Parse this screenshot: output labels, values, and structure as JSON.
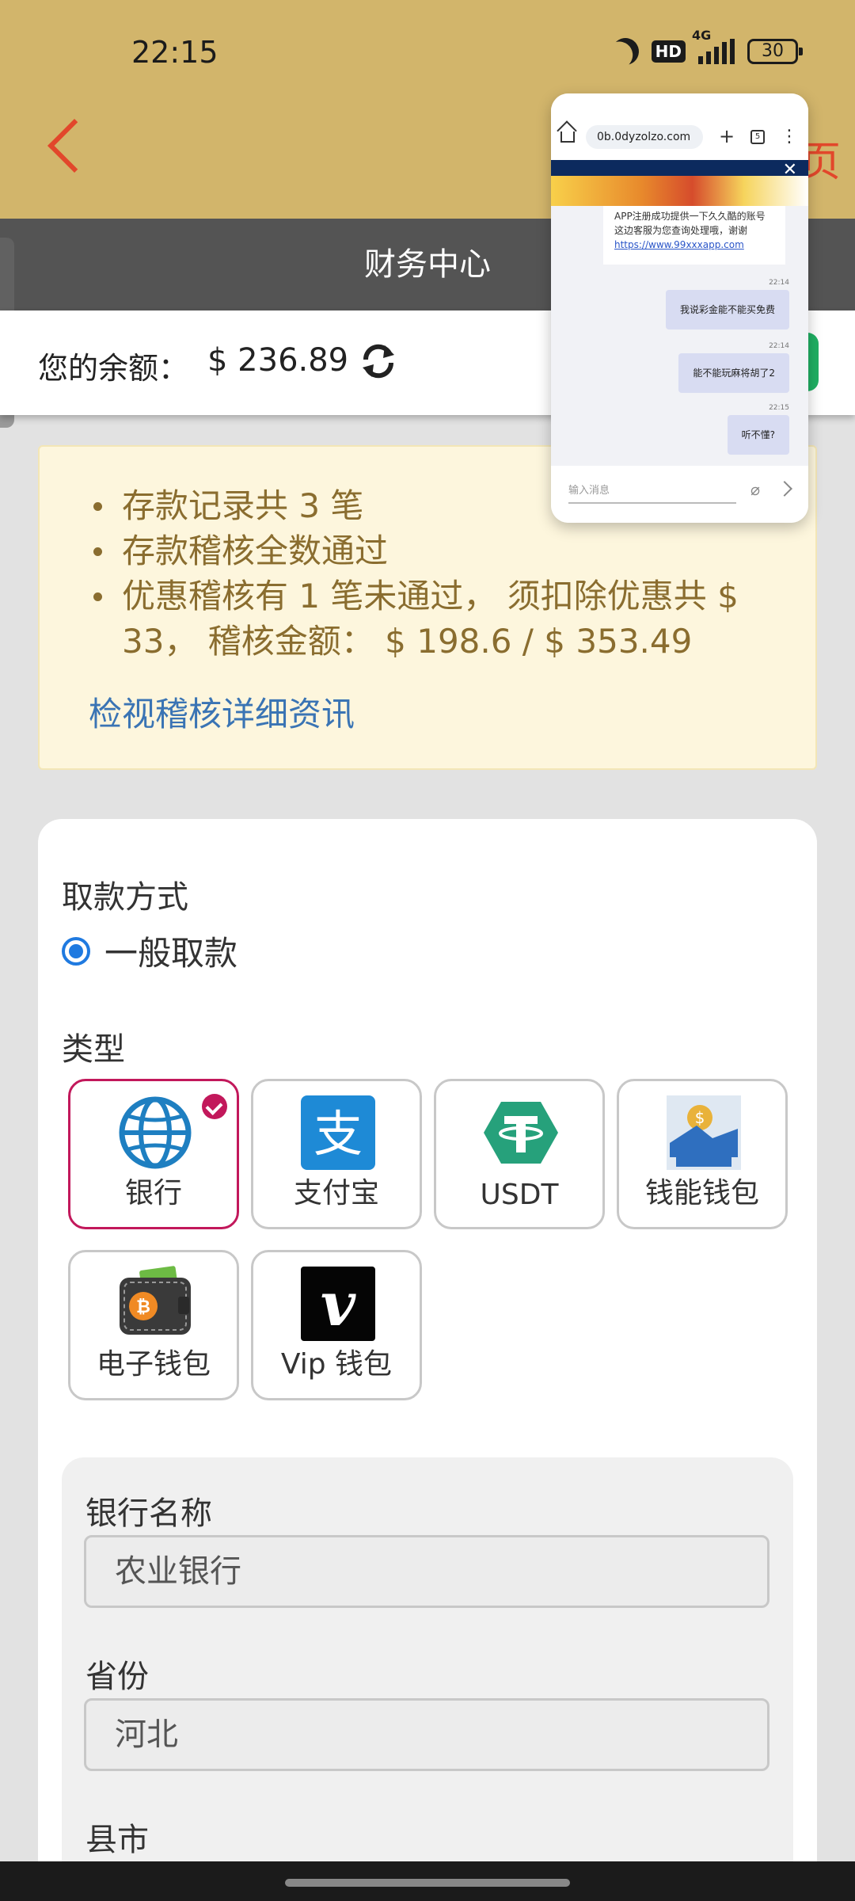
{
  "status": {
    "time": "22:15",
    "hd": "HD",
    "network": "4G",
    "battery": "30"
  },
  "header": {
    "title": "财务中心"
  },
  "balance": {
    "label": "您的余额：",
    "amount": "$ 236.89"
  },
  "notice": {
    "items": [
      "存款记录共 3 笔",
      "存款稽核全数通过",
      "优惠稽核有 1 笔未通过， 须扣除优惠共 $ 33， 稽核金额： $ 198.6 / $ 353.49"
    ],
    "detail_link": "检视稽核详细资讯"
  },
  "withdraw": {
    "method_title": "取款方式",
    "method_option": "一般取款",
    "type_title": "类型",
    "types": [
      {
        "label": "银行",
        "icon": "globe-icon",
        "selected": true
      },
      {
        "label": "支付宝",
        "icon": "alipay-icon"
      },
      {
        "label": "USDT",
        "icon": "tether-icon"
      },
      {
        "label": "钱能钱包",
        "icon": "wallet-app-icon"
      },
      {
        "label": "电子钱包",
        "icon": "bitcoin-wallet-icon"
      },
      {
        "label": "Vip 钱包",
        "icon": "vip-v-icon"
      }
    ]
  },
  "form": {
    "bank_label": "银行名称",
    "bank_value": "农业银行",
    "province_label": "省份",
    "province_value": "河北",
    "city_label": "县市"
  },
  "float_window": {
    "url": "0b.0dyzolzo.com",
    "prev_message": "APP注册成功提供一下久久酷的账号这边客服为您查询处理哦，谢谢",
    "prev_link": "https://www.99xxxapp.com",
    "messages": [
      {
        "time": "22:14",
        "text": "我说彩金能不能买免费"
      },
      {
        "time": "22:14",
        "text": "能不能玩麻将胡了2"
      },
      {
        "time": "22:15",
        "text": "听不懂?"
      }
    ],
    "input_placeholder": "输入消息"
  },
  "colors": {
    "header_bg": "#d2b56b",
    "accent_red": "#e2472b",
    "selected": "#c2185b",
    "link": "#3a74b4",
    "radio": "#1f7ae0"
  }
}
